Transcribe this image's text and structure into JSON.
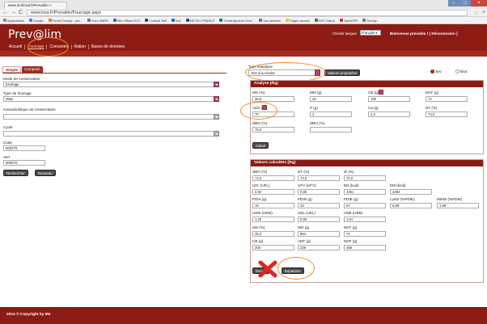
{
  "browser": {
    "tab_title": "www.inrafood.fr/Prevalim",
    "url": "www.inra.fr/Prevalim/Fourrage.aspx",
    "bookmarks": [
      {
        "label": "Applications",
        "color": "#888"
      },
      {
        "label": "Google",
        "color": "#4285f4"
      },
      {
        "label": "Portail Orange - Act...",
        "color": "#ff7900"
      },
      {
        "label": "Yves-SMRH",
        "color": "#777"
      },
      {
        "label": "Site Officiel ECF",
        "color": "#2b6cb0"
      },
      {
        "label": "Football 365",
        "color": "#444"
      },
      {
        "label": "Dell",
        "color": "#0076ce"
      },
      {
        "label": "METEO FRANCE",
        "color": "#1a4f8b"
      },
      {
        "label": "Crédit Agricole Cent...",
        "color": "#008a5e"
      },
      {
        "label": "Vos services",
        "color": "#777"
      },
      {
        "label": "Pages Jaunes",
        "color": "#f4c400"
      },
      {
        "label": "ENT Cayrol",
        "color": "#3b7a3b"
      },
      {
        "label": "OpenERP",
        "color": "#c0392b"
      },
      {
        "label": "Serelyn",
        "color": "#777"
      }
    ]
  },
  "header": {
    "brand": "Prev@lim",
    "lang_label": "Choisir langue",
    "lang_value": "Français",
    "welcome": "Bienvenue prevalim ! [ Déconnexion ]",
    "nav": [
      {
        "label": "Accueil",
        "active": false
      },
      {
        "label": "Fourrage",
        "active": true
      },
      {
        "label": "Concentré",
        "active": false
      },
      {
        "label": "Ration",
        "active": false
      },
      {
        "label": "Bases de données",
        "active": false
      }
    ]
  },
  "left": {
    "tab_simple": "Simple",
    "tab_compose": "Composé",
    "mode_label": "Mode de conservation",
    "mode_value": "Ensilage",
    "type_label": "Type de fourrage",
    "type_value": "Maïs",
    "carac_label": "Caractéristique de conservation",
    "carac_value": "",
    "cycle_label": "Cycle",
    "cycle_value": "",
    "code_label": "Code",
    "code_value": "000270",
    "vert_label": "Vert",
    "vert_value": "000070",
    "search_btn": "Rechercher",
    "new_btn": "Nouveau"
  },
  "analysis": {
    "type_label": "Type d'analyse",
    "type_value": "Vert à la récolte",
    "proposed_btn": "Valeurs proposées",
    "radio_sec": "Sec",
    "radio_brut": "Brut",
    "panel_title": "Analyse (/kg)",
    "fields": [
      {
        "label": "MS (%)",
        "value": "35,8"
      },
      {
        "label": "MM (g)",
        "value": "46"
      },
      {
        "label": "CB (g)",
        "value": "195",
        "has_select": true
      },
      {
        "label": "MAT (g)",
        "value": "72"
      },
      {
        "label": "ADS (%)",
        "value": "70",
        "has_select": true
      },
      {
        "label": "P (g)",
        "value": "2"
      },
      {
        "label": "Ca (g)",
        "value": "2,3"
      },
      {
        "label": "DT (%)",
        "value": "73,0"
      },
      {
        "label": "dMO (%)",
        "value": "75,0"
      },
      {
        "label": "dMO (%)",
        "value": ""
      }
    ],
    "calc_btn": "Calcul"
  },
  "results": {
    "panel_title": "Valeurs calculées (/kg)",
    "rows": [
      [
        {
          "label": "dMO (%)",
          "value": "72,5"
        },
        {
          "label": "DT (%)",
          "value": "73,0"
        },
        {
          "label": "dr (%)",
          "value": "70,0"
        }
      ],
      [
        {
          "label": "UFL (UFL)",
          "value": "0,92"
        },
        {
          "label": "UFV (UFV)",
          "value": "0,86"
        },
        {
          "label": "EB (kcal)",
          "value": "4451"
        },
        {
          "label": "EM (kcal)",
          "value": "2384"
        }
      ],
      [
        {
          "label": "PDIA (g)",
          "value": "15"
        },
        {
          "label": "PDIN (g)",
          "value": "43"
        },
        {
          "label": "PDIE (g)",
          "value": "67"
        },
        {
          "label": "LysDI (%PDIE)",
          "value": "6,99"
        },
        {
          "label": "MetDI (%PDIE)",
          "value": "1,99"
        }
      ],
      [
        {
          "label": "UEM (UEM)",
          "value": "1,20"
        },
        {
          "label": "UEL (UEL)",
          "value": "0,99"
        },
        {
          "label": "UEB (UEB)",
          "value": "1,61"
        }
      ],
      [
        {
          "label": "MS (%)",
          "value": "35,2"
        },
        {
          "label": "MO (g)",
          "value": "954"
        },
        {
          "label": "MAT (g)",
          "value": "71"
        }
      ],
      [
        {
          "label": "CB (g)",
          "value": "205"
        },
        {
          "label": "ADF (g)",
          "value": "229"
        },
        {
          "label": "NDF (g)",
          "value": "468"
        }
      ]
    ],
    "save_btn": "Enre...",
    "equations_btn": "Equations"
  },
  "footer": {
    "text": "2014 © Copyright by Me"
  },
  "colors": {
    "brand": "#8c1c13",
    "highlight": "#f28a1c"
  }
}
